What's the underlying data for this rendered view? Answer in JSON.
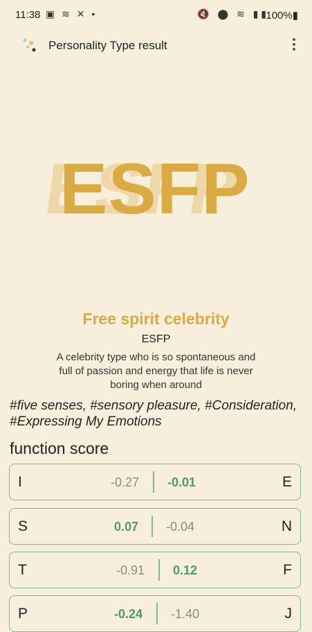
{
  "status_bar": {
    "time": "11:38",
    "left_icons": "▣ ≋ ✕ •",
    "right_icons": "🔇 ⬤ ≋ ▮▮",
    "battery": "100%▮"
  },
  "app_bar": {
    "title": "Personality Type result"
  },
  "result": {
    "type": "ESFP",
    "title": "Free spirit celebrity",
    "code": "ESFP",
    "description": "A celebrity type who is so spontaneous and full of passion and energy that life is never boring when around",
    "hashtags": "#five senses, #sensory pleasure, #Consideration, #Expressing My Emotions"
  },
  "function_score": {
    "title": "function score",
    "rows": [
      {
        "left": "I",
        "left_value": "-0.27",
        "right_value": "-0.01",
        "right": "E"
      },
      {
        "left": "S",
        "left_value": "0.07",
        "right_value": "-0.04",
        "right": "N"
      },
      {
        "left": "T",
        "left_value": "-0.91",
        "right_value": "0.12",
        "right": "F"
      },
      {
        "left": "P",
        "left_value": "-0.24",
        "right_value": "-1.40",
        "right": "J"
      }
    ]
  },
  "colors": {
    "background": "#f7eedc",
    "accent_gold": "#d9ab42",
    "accent_green": "#4d9c64",
    "border_green": "#7cba8f"
  }
}
